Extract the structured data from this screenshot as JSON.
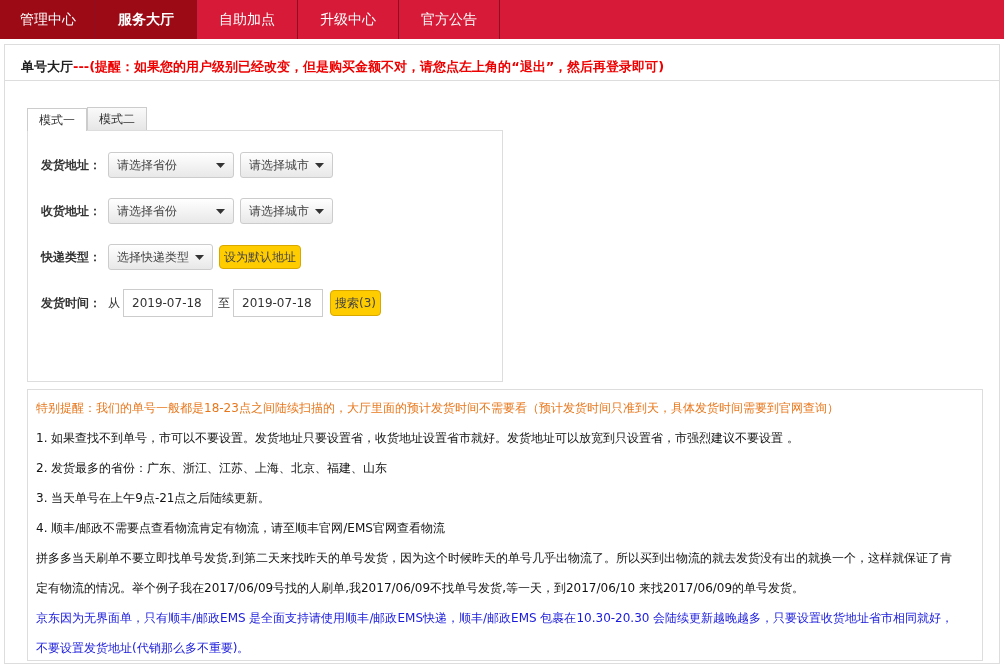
{
  "nav": [
    {
      "label": "管理中心",
      "selected": false,
      "highlighted": true
    },
    {
      "label": "服务大厅",
      "selected": true
    },
    {
      "label": "自助加点",
      "selected": false
    },
    {
      "label": "升级中心",
      "selected": false
    },
    {
      "label": "官方公告",
      "selected": false
    }
  ],
  "header": {
    "title": "单号大厅",
    "notice": "---(提醒：如果您的用户级别已经改变，但是购买金额不对，请您点左上角的“退出”，然后再登录即可)"
  },
  "mode_tabs": [
    {
      "label": "模式一",
      "selected": true
    },
    {
      "label": "模式二",
      "selected": false
    }
  ],
  "form": [
    {
      "kind": "selects",
      "label": "发货地址：",
      "selects": [
        "请选择省份",
        "请选择城市"
      ]
    },
    {
      "kind": "selects",
      "label": "收货地址：",
      "selects": [
        "请选择省份",
        "请选择城市"
      ]
    },
    {
      "kind": "express",
      "label": "快递类型：",
      "select": "选择快递类型",
      "button": "设为默认地址"
    },
    {
      "kind": "dates",
      "label": "发货时间：",
      "from_label": "从",
      "from": "2019-07-18",
      "to_label": "至",
      "to": "2019-07-18",
      "button": "搜索(3)"
    }
  ],
  "notes": [
    {
      "kind": "warning",
      "text": "特别提醒：我们的单号一般都是18-23点之间陆续扫描的，大厅里面的预计发货时间不需要看（预计发货时间只准到天，具体发货时间需要到官网查询）"
    },
    {
      "kind": "item",
      "text": "1. 如果查找不到单号，市可以不要设置。发货地址只要设置省，收货地址设置省市就好。发货地址可以放宽到只设置省，市强烈建议不要设置 。"
    },
    {
      "kind": "item",
      "text": "2. 发货最多的省份：广东、浙江、江苏、上海、北京、福建、山东"
    },
    {
      "kind": "item",
      "text": "3. 当天单号在上午9点-21点之后陆续更新。"
    },
    {
      "kind": "item",
      "text": "4. 顺丰/邮政不需要点查看物流肯定有物流，请至顺丰官网/EMS官网查看物流"
    },
    {
      "kind": "paragraph",
      "text": "拼多多当天刷单不要立即找单号发货,到第二天来找昨天的单号发货，因为这个时候昨天的单号几乎出物流了。所以买到出物流的就去发货没有出的就换一个，这样就保证了肯定有物流的情况。举个例子我在2017/06/09号找的人刷单,我2017/06/09不找单号发货,等一天，到2017/06/10 来找2017/06/09的单号发货。"
    },
    {
      "kind": "blue",
      "text": "京东因为无界面单，只有顺丰/邮政EMS 是全面支持请使用顺丰/邮政EMS快递，顺丰/邮政EMS 包裹在10.30-20.30 会陆续更新越晚越多，只要设置收货地址省市相同就好，不要设置发货地址(代销那么多不重要)。"
    }
  ]
}
